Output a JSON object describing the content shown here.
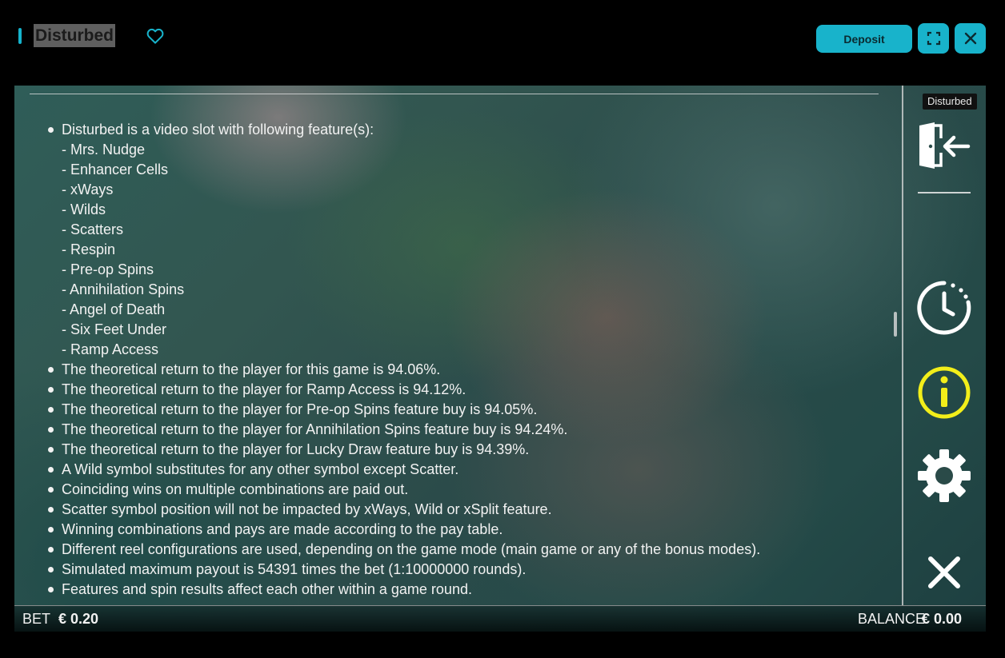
{
  "header": {
    "game_title": "Disturbed",
    "favorite_icon": "heart-outline-icon",
    "deposit_label": "Deposit",
    "fullscreen_icon": "fullscreen-icon",
    "close_icon": "close-icon",
    "accent_color": "#18b3cb"
  },
  "rules": {
    "intro": "Disturbed is a video slot with following feature(s):",
    "features": [
      "- Mrs. Nudge",
      "- Enhancer Cells",
      "- xWays",
      "- Wilds",
      "- Scatters",
      "- Respin",
      "- Pre-op Spins",
      "- Annihilation Spins",
      "- Angel of Death",
      "- Six Feet Under",
      "- Ramp Access"
    ],
    "items": [
      "The theoretical return to the player for this game is 94.06%.",
      "The theoretical return to the player for Ramp Access is 94.12%.",
      "The theoretical return to the player for Pre-op Spins feature buy is 94.05%.",
      "The theoretical return to the player for Annihilation Spins feature buy is 94.24%.",
      "The theoretical return to the player for Lucky Draw feature buy is 94.39%.",
      "A Wild symbol substitutes for any other symbol except Scatter.",
      "Coinciding wins on multiple combinations are paid out.",
      "Scatter symbol position will not be impacted by xWays, Wild or xSplit feature.",
      "Winning combinations and pays are made according to the pay table.",
      "Different reel configurations are used, depending on the game mode (main game or any of the bonus modes).",
      "Simulated maximum payout is 54391 times the bet (1:10000000 rounds).",
      "Features and spin results affect each other within a game round."
    ]
  },
  "side_menu": {
    "tooltip": "Disturbed",
    "exit_icon": "exit-door-icon",
    "history_icon": "history-clock-icon",
    "info_icon": "info-icon",
    "settings_icon": "gear-icon",
    "close_icon": "close-x-icon",
    "info_active_color": "#f2ee1a"
  },
  "footer": {
    "bet_label": "BET",
    "bet_value": "€ 0.20",
    "balance_label": "BALANCE",
    "balance_value": "€ 0.00"
  }
}
